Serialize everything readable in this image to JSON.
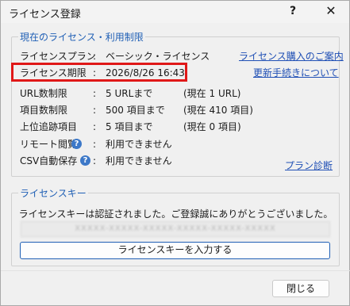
{
  "window": {
    "title": "ライセンス登録",
    "help_glyph": "?",
    "close_glyph": "✕"
  },
  "license_group": {
    "legend": "現在のライセンス・利用制限",
    "colon": ":",
    "rows": [
      {
        "label": "ライセンスプラン",
        "value": "ベーシック・ライセンス",
        "extra": ""
      },
      {
        "label": "ライセンス期限",
        "value": "2026/8/26 16:43",
        "extra": ""
      },
      {
        "label": "URL数制限",
        "value": "5 URLまで",
        "extra": "(現在 1 URL)"
      },
      {
        "label": "項目数制限",
        "value": "500 項目まで",
        "extra": "(現在 410 項目)"
      },
      {
        "label": "上位追跡項目",
        "value": "5 項目まで",
        "extra": "(現在 0 項目)"
      },
      {
        "label": "リモート閲覧",
        "value": "利用できません",
        "extra": ""
      },
      {
        "label": "CSV自動保存",
        "value": "利用できません",
        "extra": ""
      }
    ],
    "links": {
      "purchase": "ライセンス購入のご案内",
      "renew": "更新手続きについて",
      "diagnose": "プラン診断"
    },
    "help_icon": "?"
  },
  "key_group": {
    "legend": "ライセンスキー",
    "message": "ライセンスキーは認証されました。ご登録誠にありがとうございました。",
    "key_value": "XXXXX-XXXXX-XXXXX-XXXXX-XXXXX-XXXXX",
    "enter_button": "ライセンスキーを入力する"
  },
  "footer": {
    "close_button": "閉じる"
  }
}
